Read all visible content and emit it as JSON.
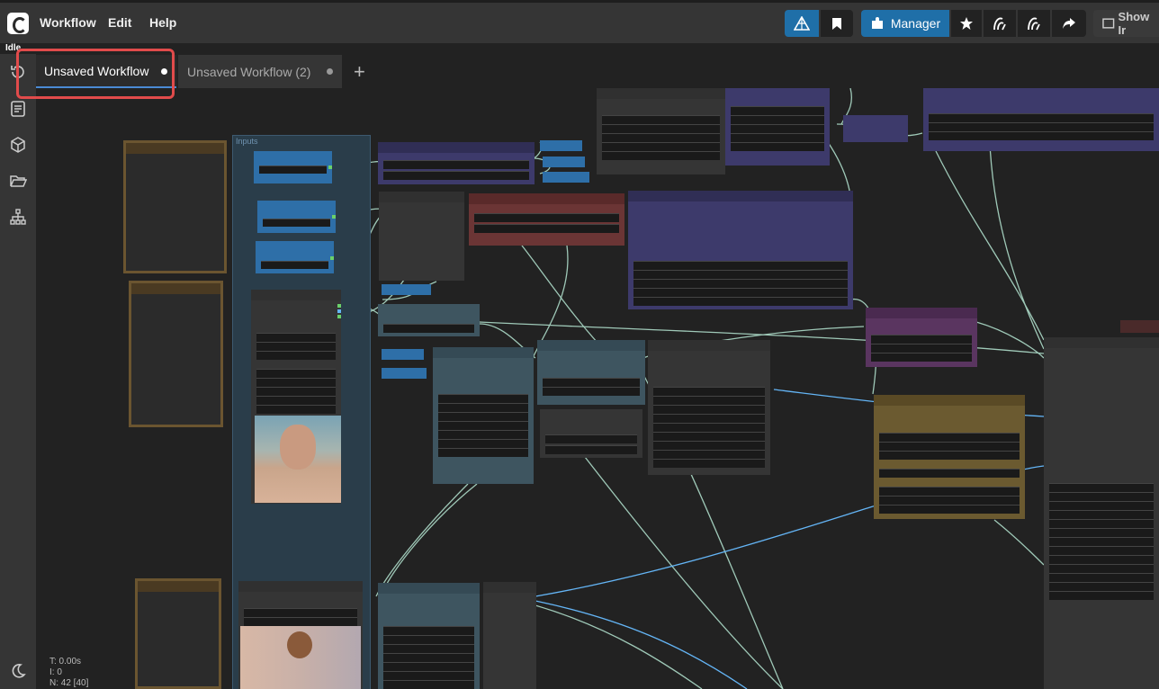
{
  "menu": {
    "workflow": "Workflow",
    "edit": "Edit",
    "help": "Help"
  },
  "toolbar": {
    "manager_label": "Manager",
    "show_label": "Show Ir"
  },
  "status": {
    "idle": "Idle"
  },
  "tabs": [
    {
      "label": "Unsaved Workflow",
      "active": true
    },
    {
      "label": "Unsaved Workflow (2)",
      "active": false
    }
  ],
  "canvas": {
    "group_title": "Inputs"
  },
  "stats": {
    "t": "T: 0.00s",
    "i": "I: 0",
    "n": "N: 42 [40]"
  },
  "colors": {
    "accent": "#1f6fa8",
    "highlight": "#e14b4b",
    "link_blue": "#64b5f6"
  }
}
